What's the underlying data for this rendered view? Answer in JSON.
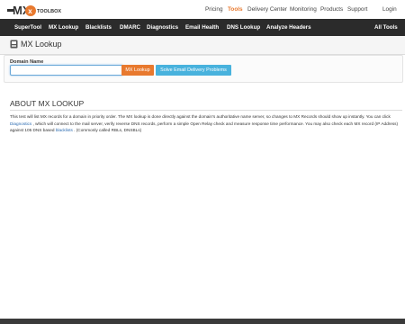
{
  "brand": {
    "logo_text": "TOOLBOX",
    "logo_mark": "MX"
  },
  "top_nav": {
    "items": [
      {
        "label": "Pricing"
      },
      {
        "label": "Tools",
        "active": true
      },
      {
        "label": "Delivery Center"
      },
      {
        "label": "Monitoring"
      },
      {
        "label": "Products"
      },
      {
        "label": "Support"
      }
    ],
    "login": "Login"
  },
  "main_nav": {
    "items": [
      {
        "label": "SuperTool"
      },
      {
        "label": "MX Lookup"
      },
      {
        "label": "Blacklists"
      },
      {
        "label": "DMARC"
      },
      {
        "label": "Diagnostics"
      },
      {
        "label": "Email Health"
      },
      {
        "label": "DNS Lookup"
      },
      {
        "label": "Analyze Headers"
      }
    ],
    "all_tools": "All Tools"
  },
  "page": {
    "title": "MX Lookup"
  },
  "form": {
    "domain_label": "Domain Name",
    "domain_value": "",
    "mx_button": "MX Lookup",
    "solve_button": "Solve Email Delivery Problems"
  },
  "about": {
    "heading": "ABOUT MX LOOKUP",
    "text_1": "This test will list MX records for a domain in priority order. The MX lookup is done directly against the domain's authoritative name server, so changes to MX Records should show up instantly. You can click ",
    "link_diagnostics": "Diagnostics",
    "text_2": " , which will connect to the mail server, verify reverse DNS records, perform a simple Open Relay check and measure response time performance. You may also check each MX record (IP Address) against 105 DNS based ",
    "link_blacklists": "blacklists",
    "text_3": " . (Commonly called RBLs, DNSBLs)"
  },
  "colors": {
    "accent_orange": "#e8792e",
    "accent_blue": "#48b2dd",
    "nav_dark": "#2b2b2b",
    "link": "#2a6ab0"
  }
}
